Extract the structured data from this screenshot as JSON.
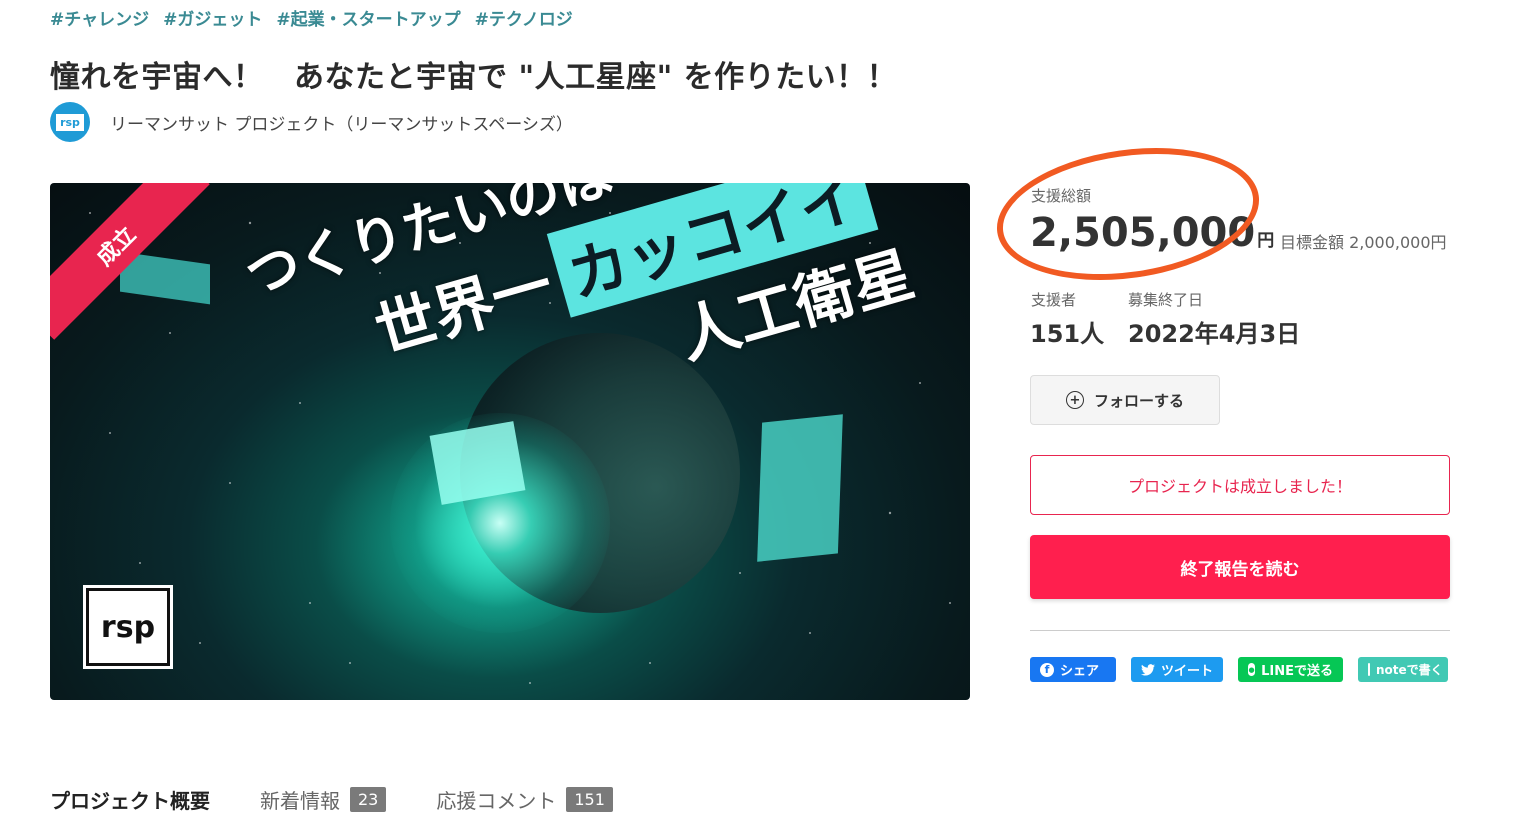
{
  "tags": [
    "#チャレンジ",
    "#ガジェット",
    "#起業・スタートアップ",
    "#テクノロジ"
  ],
  "title": "憧れを宇宙へ！　あなたと宇宙で \"人工星座\" を作りたい！！",
  "owner": {
    "avatar_text": "rsp",
    "name": "リーマンサット プロジェクト（リーマンサットスペーシズ）"
  },
  "hero": {
    "ribbon": "成立",
    "line1": "つくりたいのは",
    "line2a": "世界一",
    "line2b": "カッコイイ",
    "line3": "人工衛星",
    "logo": "rsp"
  },
  "funding": {
    "total_label": "支援総額",
    "total_amount": "2,505,000",
    "currency": "円",
    "goal": "目標金額 2,000,000円",
    "supporters_label": "支援者",
    "supporters_value": "151人",
    "end_label": "募集終了日",
    "end_value": "2022年4月3日"
  },
  "actions": {
    "follow": "フォローする",
    "success_message": "プロジェクトは成立しました！",
    "report": "終了報告を読む"
  },
  "share": {
    "facebook": "シェア",
    "twitter": "ツイート",
    "line": "LINEで送る",
    "note": "noteで書く"
  },
  "tabs": [
    {
      "label": "プロジェクト概要",
      "count": ""
    },
    {
      "label": "新着情報",
      "count": "23"
    },
    {
      "label": "応援コメント",
      "count": "151"
    }
  ],
  "colors": {
    "accent": "#ff1f4e",
    "tag": "#3a8a93",
    "annotation": "#f15a22"
  }
}
